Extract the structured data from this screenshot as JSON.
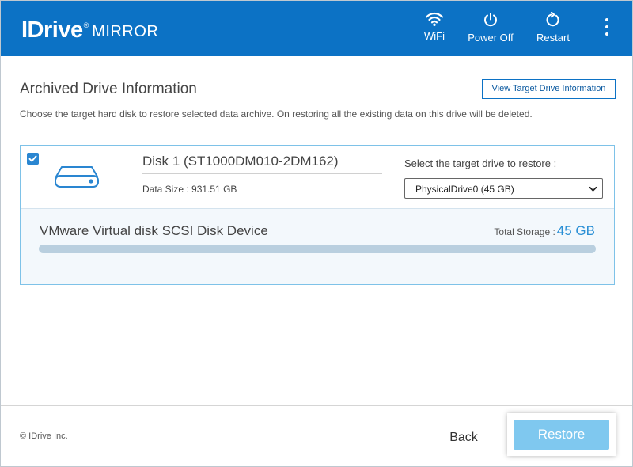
{
  "header": {
    "logo_brand": "IDrive",
    "logo_registered": "®",
    "logo_product": "MIRROR",
    "wifi_label": "WiFi",
    "power_label": "Power Off",
    "restart_label": "Restart",
    "more_icon": "vertical-ellipsis-icon",
    "bg_color": "#0c72c5"
  },
  "main": {
    "title": "Archived Drive Information",
    "view_target_label": "View Target Drive Information",
    "description": "Choose the target hard disk to restore selected data archive. On restoring all the existing data on this drive will be deleted."
  },
  "disk": {
    "checked": true,
    "icon": "hard-drive-icon",
    "name": "Disk 1 (ST1000DM010-2DM162)",
    "data_size_label": "Data Size : 931.51 GB",
    "select_label": "Select the target drive to restore :",
    "selected_drive": "PhysicalDrive0 (45 GB)",
    "device_name": "VMware Virtual disk SCSI Disk Device",
    "total_storage_label": "Total Storage :",
    "total_storage_value": "45 GB",
    "used_fraction": 0
  },
  "footer": {
    "copyright": "© IDrive Inc.",
    "back_label": "Back",
    "restore_label": "Restore",
    "restore_color": "#7fc8ef"
  }
}
